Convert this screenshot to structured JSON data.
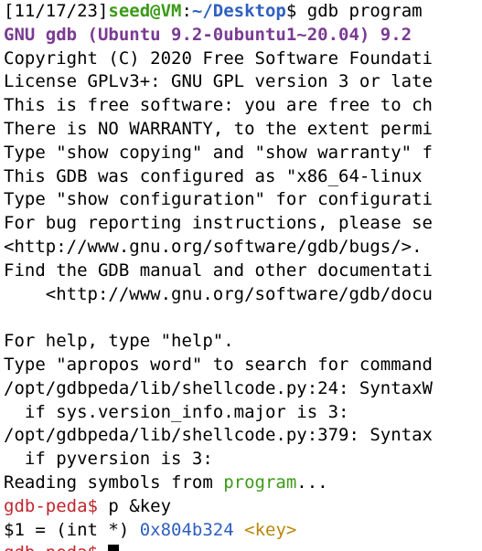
{
  "shell": {
    "date": "[11/17/23]",
    "user_host": "seed@VM",
    "colon": ":",
    "path": "~/Desktop",
    "command": "$ gdb program"
  },
  "banner": "GNU gdb (Ubuntu 9.2-0ubuntu1~20.04) 9.2",
  "output_lines": [
    "Copyright (C) 2020 Free Software Foundati",
    "License GPLv3+: GNU GPL version 3 or late",
    "This is free software: you are free to ch",
    "There is NO WARRANTY, to the extent permi",
    "Type \"show copying\" and \"show warranty\" f",
    "This GDB was configured as \"x86_64-linux",
    "Type \"show configuration\" for configurati",
    "For bug reporting instructions, please se",
    "<http://www.gnu.org/software/gdb/bugs/>.",
    "Find the GDB manual and other documentati",
    "    <http://www.gnu.org/software/gdb/docu"
  ],
  "help_lines": [
    "For help, type \"help\".",
    "Type \"apropos word\" to search for command",
    "/opt/gdbpeda/lib/shellcode.py:24: SyntaxW",
    "  if sys.version_info.major is 3:",
    "/opt/gdbpeda/lib/shellcode.py:379: Syntax",
    "  if pyversion is 3:"
  ],
  "reading": {
    "prefix": "Reading symbols from ",
    "file": "program",
    "suffix": "..."
  },
  "peda_prompt": "gdb-peda$",
  "peda_command": " p &key",
  "result": {
    "prefix": "$1 = (int *) ",
    "address": "0x804b324",
    "symbol": "<key>"
  },
  "next_prompt": "gdb-peda$"
}
